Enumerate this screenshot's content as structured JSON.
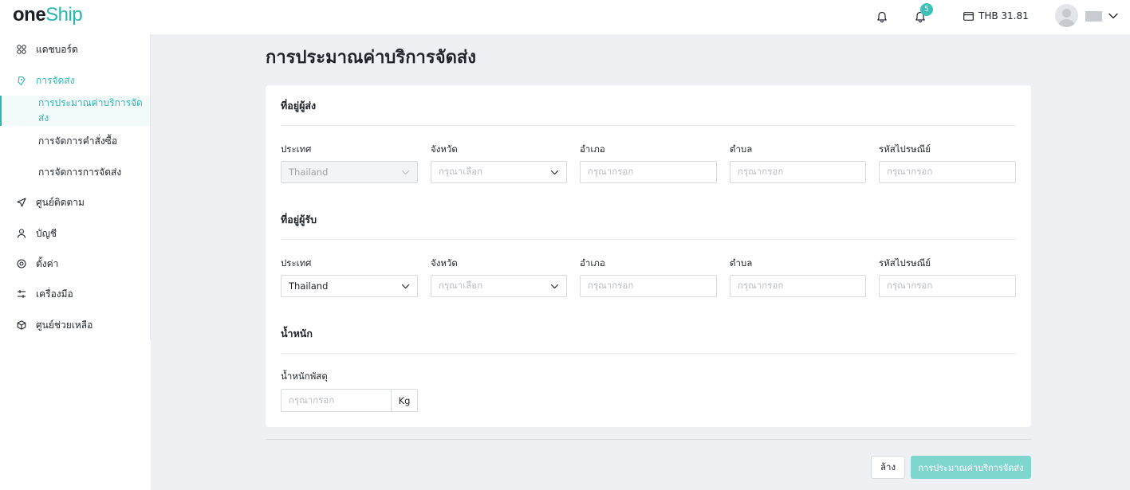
{
  "header": {
    "logo_one": "one",
    "logo_ship": "Ship",
    "notification_icon": "bell-icon",
    "sync_icon": "refresh-bell-icon",
    "sync_badge": "5",
    "balance_icon": "wallet-icon",
    "balance": "THB 31.81"
  },
  "sidebar": {
    "items": [
      {
        "label": "แดชบอร์ด",
        "icon": "dashboard-icon"
      },
      {
        "label": "การจัดส่ง",
        "icon": "delivery-icon"
      },
      {
        "label": "ศูนย์ติดตาม",
        "icon": "send-icon"
      },
      {
        "label": "บัญชี",
        "icon": "user-icon"
      },
      {
        "label": "ตั้งค่า",
        "icon": "settings-icon"
      },
      {
        "label": "เครื่องมือ",
        "icon": "tools-icon"
      },
      {
        "label": "ศูนย์ช่วยเหลือ",
        "icon": "help-box-icon"
      }
    ],
    "sub_items": [
      {
        "label": "การประมาณค่าบริการจัดส่ง"
      },
      {
        "label": "การจัดการคำสั่งซื้อ"
      },
      {
        "label": "การจัดการการจัดส่ง"
      }
    ]
  },
  "page": {
    "title": "การประมาณค่าบริการจัดส่ง"
  },
  "sender": {
    "title": "ที่อยู่ผู้ส่ง",
    "country_label": "ประเทศ",
    "country_value": "Thailand",
    "province_label": "จังหวัด",
    "province_placeholder": "กรุณาเลือก",
    "district_label": "อำเภอ",
    "district_placeholder": "กรุณากรอก",
    "subdistrict_label": "ตำบล",
    "subdistrict_placeholder": "กรุณากรอก",
    "postcode_label": "รหัสไปรษณีย์",
    "postcode_placeholder": "กรุณากรอก"
  },
  "receiver": {
    "title": "ที่อยู่ผู้รับ",
    "country_label": "ประเทศ",
    "country_value": "Thailand",
    "province_label": "จังหวัด",
    "province_placeholder": "กรุณาเลือก",
    "district_label": "อำเภอ",
    "district_placeholder": "กรุณากรอก",
    "subdistrict_label": "ตำบล",
    "subdistrict_placeholder": "กรุณากรอก",
    "postcode_label": "รหัสไปรษณีย์",
    "postcode_placeholder": "กรุณากรอก"
  },
  "weight": {
    "title": "น้ำหนัก",
    "label": "น้ำหนักพัสดุ",
    "placeholder": "กรุณากรอก",
    "unit": "Kg"
  },
  "actions": {
    "clear": "ล้าง",
    "estimate": "การประมาณค่าบริการจัดส่ง"
  },
  "colors": {
    "accent": "#2bb5b0",
    "button_primary": "#7fd6cf",
    "background": "#eef0f4"
  }
}
